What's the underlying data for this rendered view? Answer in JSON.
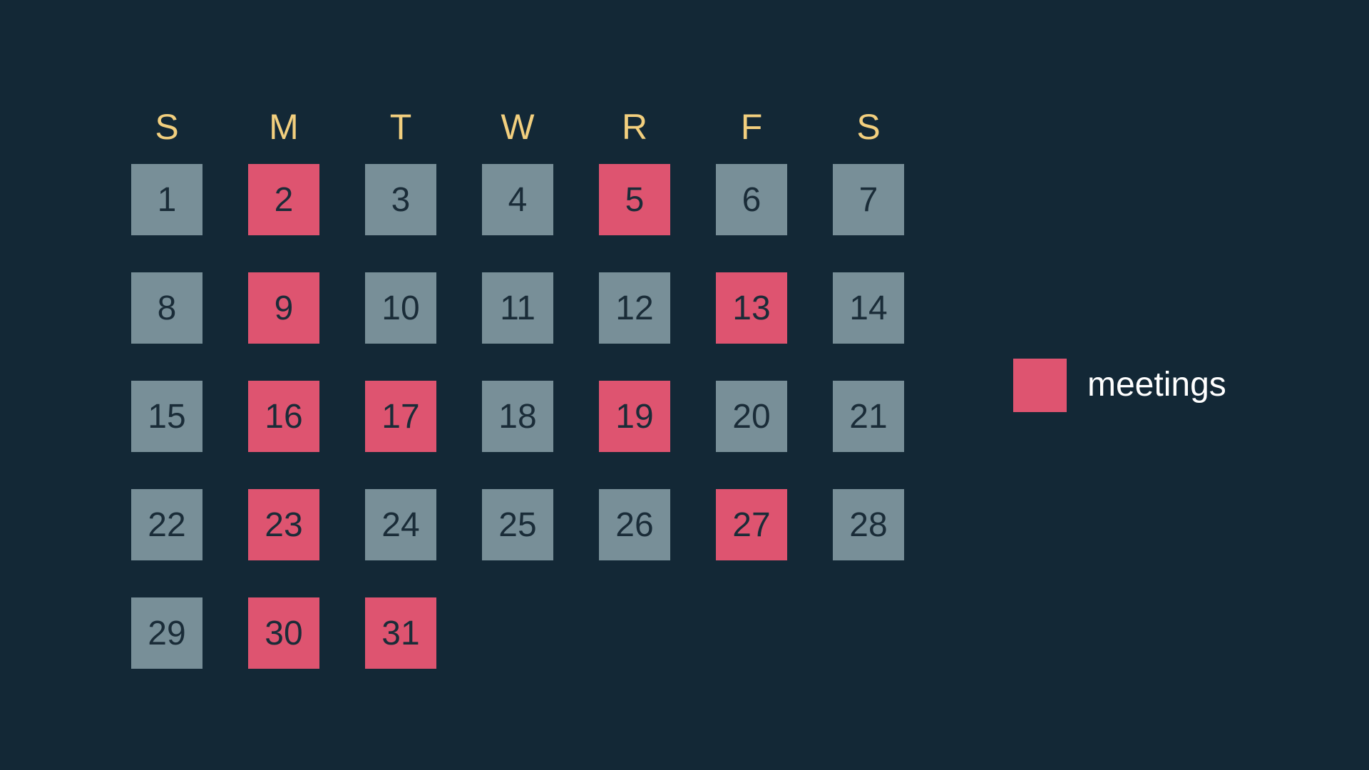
{
  "chart_data": {
    "type": "calendar-heatmap",
    "weekday_headers": [
      "S",
      "M",
      "T",
      "W",
      "R",
      "F",
      "S"
    ],
    "first_weekday_index": 0,
    "days": [
      1,
      2,
      3,
      4,
      5,
      6,
      7,
      8,
      9,
      10,
      11,
      12,
      13,
      14,
      15,
      16,
      17,
      18,
      19,
      20,
      21,
      22,
      23,
      24,
      25,
      26,
      27,
      28,
      29,
      30,
      31
    ],
    "highlighted_days": [
      2,
      5,
      9,
      13,
      16,
      17,
      19,
      23,
      27,
      30,
      31
    ],
    "legend": [
      {
        "label": "meetings",
        "color": "#de5470"
      }
    ]
  },
  "colors": {
    "background": "#132836",
    "default_cell": "#788f98",
    "highlight_cell": "#de5470",
    "header_text": "#f2cf7e",
    "cell_text": "#1a2c38",
    "legend_text": "#ffffff"
  }
}
